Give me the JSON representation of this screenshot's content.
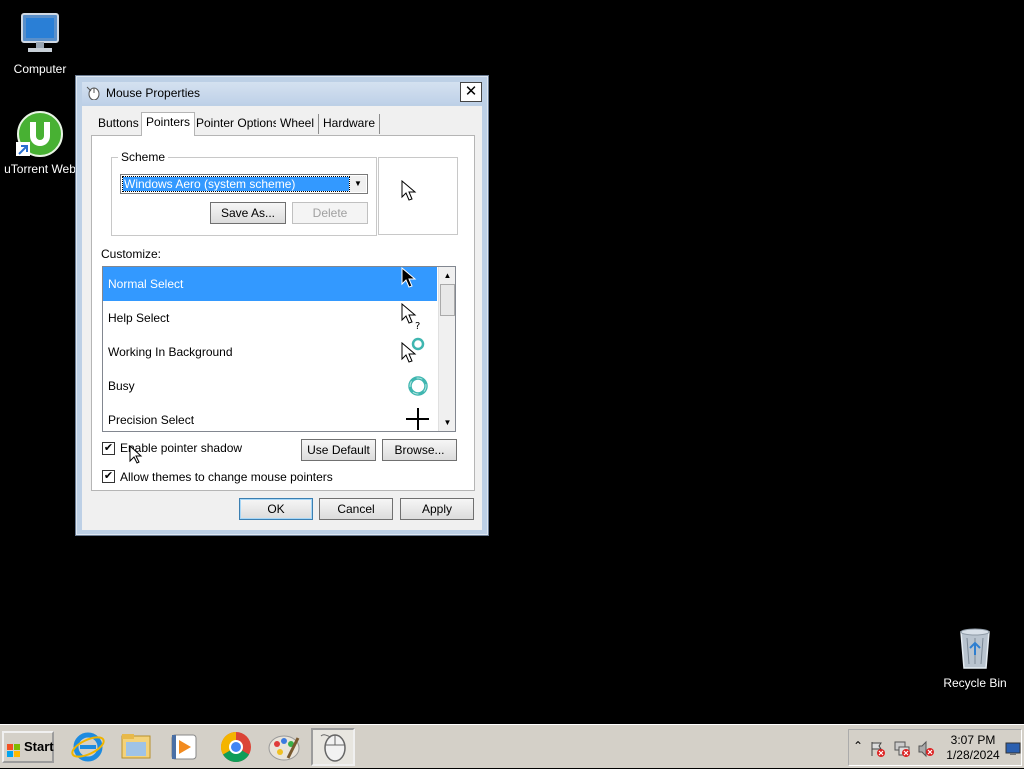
{
  "desktop": {
    "icons": [
      {
        "label": "Computer"
      },
      {
        "label": "uTorrent Web"
      },
      {
        "label": "Recycle Bin"
      }
    ]
  },
  "dialog": {
    "title": "Mouse Properties",
    "close_glyph": "✕",
    "tabs": [
      {
        "label": "Buttons",
        "active": false
      },
      {
        "label": "Pointers",
        "active": true
      },
      {
        "label": "Pointer Options",
        "active": false
      },
      {
        "label": "Wheel",
        "active": false
      },
      {
        "label": "Hardware",
        "active": false
      }
    ],
    "scheme": {
      "group_label": "Scheme",
      "selected_value": "Windows Aero (system scheme)",
      "save_as_label": "Save As...",
      "delete_label": "Delete"
    },
    "customize_label": "Customize:",
    "cursor_list": [
      {
        "label": "Normal Select",
        "icon": "arrow-cursor-icon",
        "selected": true
      },
      {
        "label": "Help Select",
        "icon": "help-cursor-icon",
        "selected": false
      },
      {
        "label": "Working In Background",
        "icon": "working-cursor-icon",
        "selected": false
      },
      {
        "label": "Busy",
        "icon": "busy-cursor-icon",
        "selected": false
      },
      {
        "label": "Precision Select",
        "icon": "crosshair-cursor-icon",
        "selected": false
      }
    ],
    "enable_shadow": {
      "label": "Enable pointer shadow",
      "checked": true
    },
    "allow_themes": {
      "label": "Allow themes to change mouse pointers",
      "checked": true
    },
    "use_default_label": "Use Default",
    "browse_label": "Browse...",
    "ok_label": "OK",
    "cancel_label": "Cancel",
    "apply_label": "Apply",
    "checkmark": "✔"
  },
  "taskbar": {
    "start_label": "Start",
    "pinned": [
      {
        "icon": "internet-explorer-icon"
      },
      {
        "icon": "file-explorer-icon"
      },
      {
        "icon": "media-player-icon"
      },
      {
        "icon": "chrome-icon"
      },
      {
        "icon": "paint-icon"
      },
      {
        "icon": "mouse-icon",
        "active": true
      }
    ],
    "tray": {
      "time": "3:07 PM",
      "date": "1/28/2024",
      "expand_glyph": "⌃"
    }
  },
  "colors": {
    "selection": "#3399ff",
    "dialog_frame": "#bdd0e6",
    "desktop": "#000000"
  }
}
